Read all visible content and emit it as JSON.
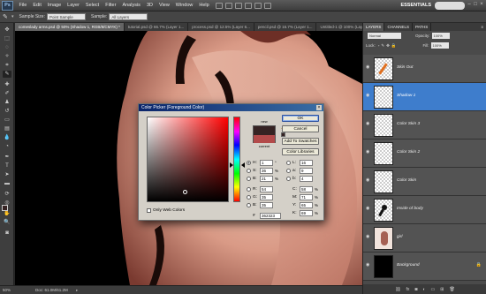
{
  "app": {
    "logo": "Ps",
    "menu": [
      "File",
      "Edit",
      "Image",
      "Layer",
      "Select",
      "Filter",
      "Analysis",
      "3D",
      "View",
      "Window",
      "Help"
    ],
    "workspace": "ESSENTIALS"
  },
  "options": {
    "sample_size_label": "Sample Size:",
    "sample_size_value": "Point Sample",
    "sample_label": "Sample:",
    "sample_value": "All Layers"
  },
  "tabs": [
    "comeslady arms.psd @ 50% (Shadow 1, RGB/8/CMYK) *",
    "tutorial.psd @ 66.7% (Layer 1...",
    "process.psd @ 12.5% (Layer 6...",
    "pencil.psd @ 16.7% (Layer 1...",
    "Untitled-1 @ 100% (Layer 1..."
  ],
  "status": {
    "zoom": "50%",
    "doc": "Doc: 61.0M/61.2M"
  },
  "color_picker": {
    "title": "Color Picker (Foreground Color)",
    "new_label": "new",
    "current_label": "current",
    "new_color": "#362323",
    "current_color": "#b34a4a",
    "buttons": {
      "ok": "OK",
      "cancel": "Cancel",
      "add_swatches": "Add To Swatches",
      "libraries": "Color Libraries"
    },
    "hsb": [
      {
        "label": "H:",
        "value": "1",
        "unit": "°"
      },
      {
        "label": "S:",
        "value": "36",
        "unit": "%"
      },
      {
        "label": "B:",
        "value": "21",
        "unit": "%"
      }
    ],
    "rgb": [
      {
        "label": "R:",
        "value": "54",
        "unit": ""
      },
      {
        "label": "G:",
        "value": "35",
        "unit": ""
      },
      {
        "label": "B:",
        "value": "35",
        "unit": ""
      }
    ],
    "lab": [
      {
        "label": "L:",
        "value": "16",
        "unit": ""
      },
      {
        "label": "a:",
        "value": "9",
        "unit": ""
      },
      {
        "label": "b:",
        "value": "4",
        "unit": ""
      }
    ],
    "cmyk": [
      {
        "label": "C:",
        "value": "58",
        "unit": "%"
      },
      {
        "label": "M:",
        "value": "71",
        "unit": "%"
      },
      {
        "label": "Y:",
        "value": "65",
        "unit": "%"
      },
      {
        "label": "K:",
        "value": "69",
        "unit": "%"
      }
    ],
    "hex_label": "#",
    "hex": "362323",
    "web_colors": "Only Web Colors"
  },
  "layers_panel": {
    "tabs": [
      "LAYERS",
      "CHANNELS",
      "PATHS"
    ],
    "blend_mode": "Normal",
    "opacity_label": "Opacity:",
    "opacity": "100%",
    "lock_label": "Lock:",
    "fill_label": "Fill:",
    "fill": "100%",
    "layers": [
      {
        "name": "Skin Out",
        "selected": false
      },
      {
        "name": "Shadow 1",
        "selected": true
      },
      {
        "name": "Color Skin 3",
        "selected": false
      },
      {
        "name": "Color Skin 2",
        "selected": false
      },
      {
        "name": "Color Skin",
        "selected": false
      },
      {
        "name": "Inside of body",
        "selected": false
      },
      {
        "name": "girl",
        "selected": false
      },
      {
        "name": "Background",
        "selected": false
      }
    ]
  }
}
